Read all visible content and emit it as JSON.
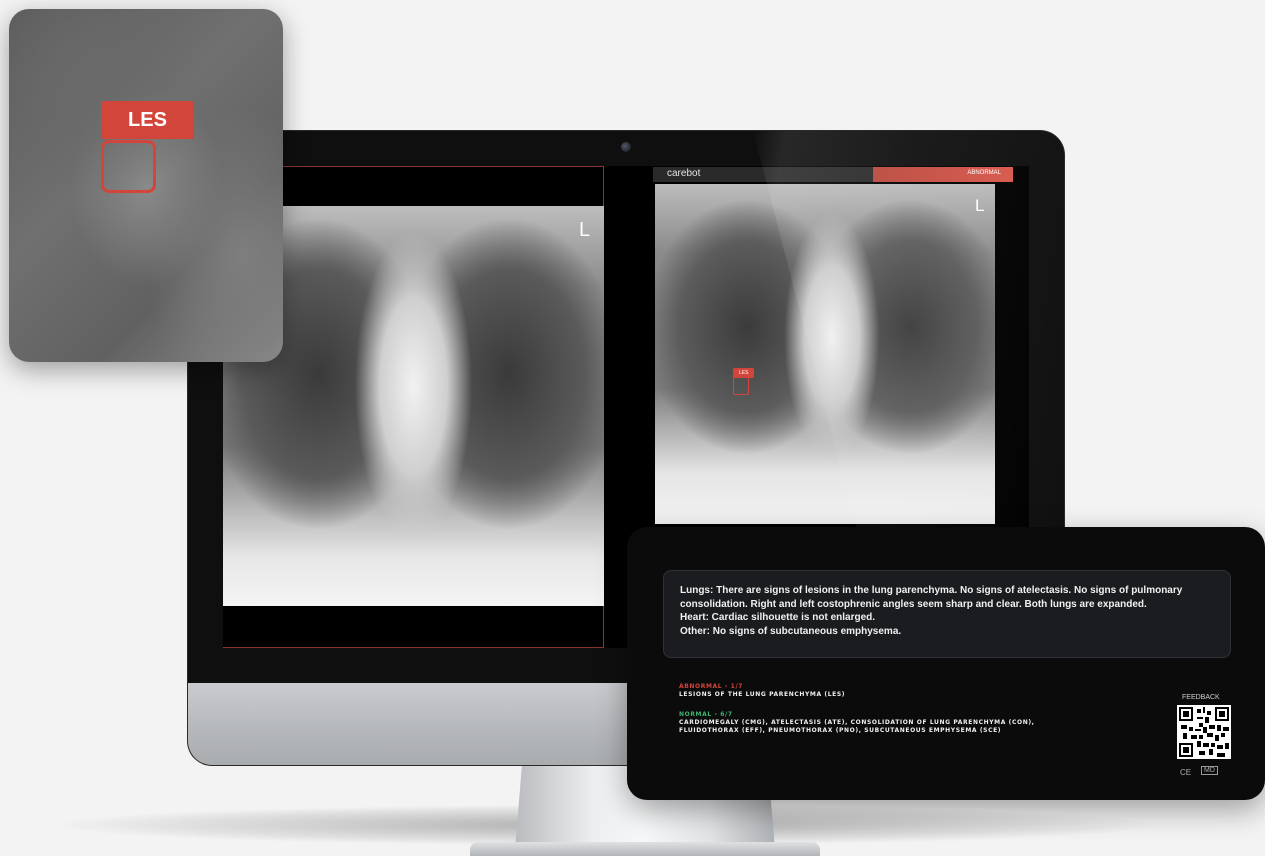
{
  "zoom": {
    "tag_label": "LES"
  },
  "viewer": {
    "left_side_marker": "L",
    "right_side_marker": "L",
    "brand": "carebot",
    "status_label": "ABNORMAL",
    "mini_tag": "LES"
  },
  "report": {
    "findings": [
      "Lungs: There are signs of lesions in the lung parenchyma. No signs of atelectasis. No signs of pulmonary consolidation. Right and left costophrenic angles seem sharp and clear. Both lungs are expanded.",
      "Heart: Cardiac silhouette is not enlarged.",
      "Other: No signs of subcutaneous emphysema."
    ],
    "abnormal_heading": "ABNORMAL - 1/7",
    "abnormal_items": "LESIONS OF THE LUNG PARENCHYMA (LES)",
    "normal_heading": "NORMAL - 6/7",
    "normal_items_line1": "CARDIOMEGALY (CMG), ATELECTASIS (ATE), CONSOLIDATION OF LUNG PARENCHYMA (CON),",
    "normal_items_line2": "FLUIDOTHORAX (EFF), PNEUMOTHORAX (PNO), SUBCUTANEOUS EMPHYSEMA (SCE)",
    "feedback_label": "FEEDBACK",
    "cert_mark": "CE",
    "cert_md": "MD"
  },
  "colors": {
    "accent_red": "#d2453a",
    "normal_green": "#3fb36b"
  }
}
